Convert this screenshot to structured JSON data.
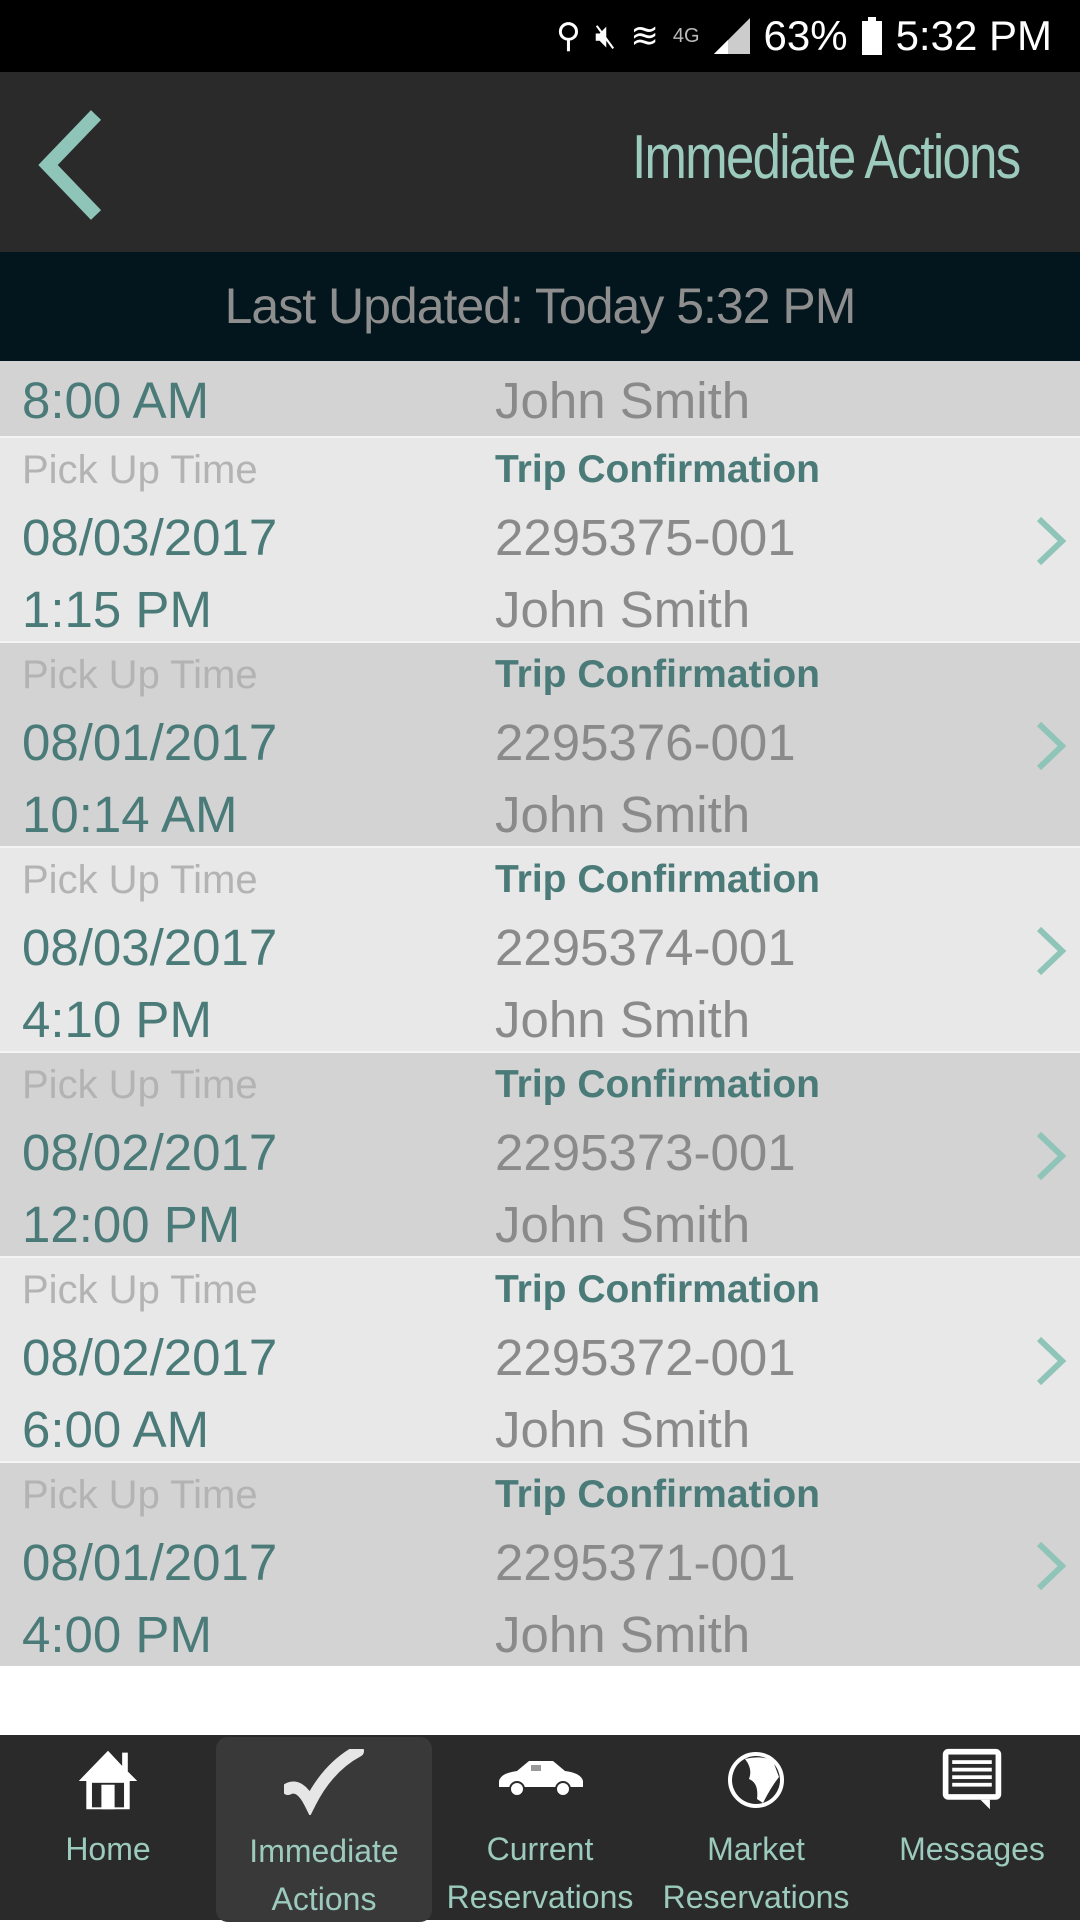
{
  "status_bar": {
    "battery": "63%",
    "time": "5:32 PM",
    "network": "4G"
  },
  "header": {
    "title": "Immediate Actions"
  },
  "last_updated": "Last Updated: Today  5:32 PM",
  "partial_row": {
    "time": "8:00 AM",
    "name": "John Smith"
  },
  "trips": [
    {
      "label": "Pick Up Time",
      "confirmation_label": "Trip Confirmation",
      "date": "08/03/2017",
      "confirmation": "2295375-001",
      "time": "1:15 PM",
      "name": "John Smith"
    },
    {
      "label": "Pick Up Time",
      "confirmation_label": "Trip Confirmation",
      "date": "08/01/2017",
      "confirmation": "2295376-001",
      "time": "10:14 AM",
      "name": "John Smith"
    },
    {
      "label": "Pick Up Time",
      "confirmation_label": "Trip Confirmation",
      "date": "08/03/2017",
      "confirmation": "2295374-001",
      "time": "4:10 PM",
      "name": "John Smith"
    },
    {
      "label": "Pick Up Time",
      "confirmation_label": "Trip Confirmation",
      "date": "08/02/2017",
      "confirmation": "2295373-001",
      "time": "12:00 PM",
      "name": "John Smith"
    },
    {
      "label": "Pick Up Time",
      "confirmation_label": "Trip Confirmation",
      "date": "08/02/2017",
      "confirmation": "2295372-001",
      "time": "6:00 AM",
      "name": "John Smith"
    },
    {
      "label": "Pick Up Time",
      "confirmation_label": "Trip Confirmation",
      "date": "08/01/2017",
      "confirmation": "2295371-001",
      "time": "4:00 PM",
      "name": "John Smith"
    }
  ],
  "nav": [
    {
      "label1": "Home",
      "label2": "",
      "icon": "home-icon"
    },
    {
      "label1": "Immediate",
      "label2": "Actions",
      "icon": "checkmark-icon",
      "active": true
    },
    {
      "label1": "Current",
      "label2": "Reservations",
      "icon": "car-icon"
    },
    {
      "label1": "Market",
      "label2": "Reservations",
      "icon": "globe-icon"
    },
    {
      "label1": "Messages",
      "label2": "",
      "icon": "message-icon"
    }
  ],
  "colors": {
    "accent": "#9ccbbd",
    "teal_text": "#4a7b78",
    "header_bg": "#2a2a2a",
    "updated_bg": "#03161d"
  }
}
